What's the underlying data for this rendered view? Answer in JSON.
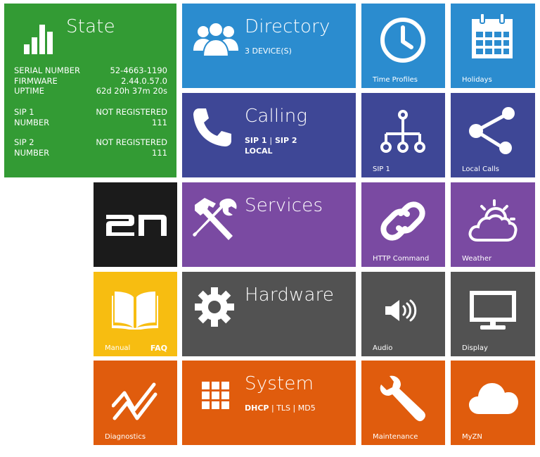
{
  "state": {
    "title": "State",
    "serial_label": "SERIAL NUMBER",
    "serial_value": "52-4663-1190",
    "firmware_label": "FIRMWARE",
    "firmware_value": "2.44.0.57.0",
    "uptime_label": "UPTIME",
    "uptime_value": "62d 20h 37m 20s",
    "sip1_label": "SIP 1",
    "sip1_status": "NOT REGISTERED",
    "sip1_number_label": "NUMBER",
    "sip1_number_value": "111",
    "sip2_label": "SIP 2",
    "sip2_status": "NOT REGISTERED",
    "sip2_number_label": "NUMBER",
    "sip2_number_value": "111"
  },
  "directory": {
    "title": "Directory",
    "subtitle": "3 DEVICE(S)"
  },
  "time_profiles": {
    "label": "Time Profiles",
    "icon": "clock-icon"
  },
  "holidays": {
    "label": "Holidays",
    "icon": "calendar-icon"
  },
  "calling": {
    "title": "Calling",
    "sip1": "SIP 1",
    "separator": "|",
    "sip2": "SIP 2",
    "local": "LOCAL"
  },
  "sip1_tile": {
    "label": "SIP 1",
    "icon": "hierarchy-icon"
  },
  "local_calls": {
    "label": "Local Calls",
    "icon": "share-icon"
  },
  "logo": {
    "text": "2N"
  },
  "services": {
    "title": "Services"
  },
  "http_command": {
    "label": "HTTP Command",
    "icon": "link-icon"
  },
  "weather": {
    "label": "Weather",
    "icon": "weather-icon"
  },
  "manual": {
    "label": "Manual",
    "faq": "FAQ",
    "icon": "book-icon"
  },
  "hardware": {
    "title": "Hardware"
  },
  "audio": {
    "label": "Audio",
    "icon": "speaker-icon"
  },
  "display": {
    "label": "Display",
    "icon": "monitor-icon"
  },
  "diagnostics": {
    "label": "Diagnostics",
    "icon": "diagnostics-icon"
  },
  "system": {
    "title": "System",
    "dhcp": "DHCP",
    "sep": "|",
    "tls": "TLS",
    "md5": "MD5"
  },
  "maintenance": {
    "label": "Maintenance",
    "icon": "wrench-icon"
  },
  "myzn": {
    "label": "MyZN",
    "icon": "cloud-icon"
  },
  "colors": {
    "green": "#339b34",
    "blue": "#2b8ccf",
    "indigo": "#3e4796",
    "black": "#1b1b1b",
    "purple": "#7a4aa2",
    "gray": "#525252",
    "yellow": "#f7bd11",
    "orange": "#e05c0d"
  }
}
